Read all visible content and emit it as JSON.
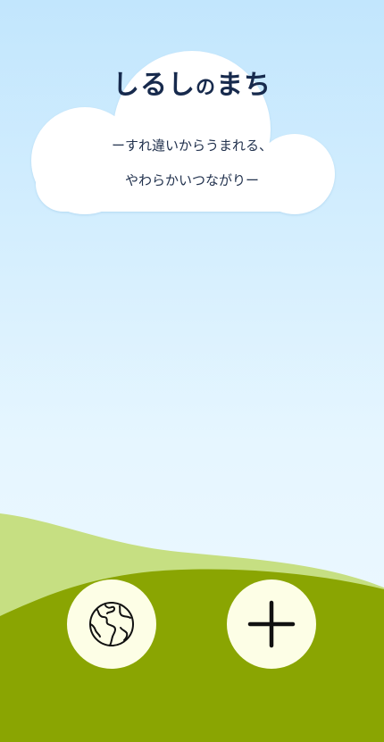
{
  "app": {
    "title_main": "しるし",
    "title_particle": "の",
    "title_end": "まち",
    "tagline_line1": "ーすれ違いからうまれる、",
    "tagline_line2": "やわらかいつながりー"
  },
  "colors": {
    "sky_top": "#c2e6fd",
    "sky_bottom": "#eef9ff",
    "cloud": "#ffffff",
    "hill_back": "#c6df82",
    "hill_front": "#8aa502",
    "button_bg": "#fdfee6",
    "title_text": "#172a4d"
  },
  "buttons": {
    "explore": {
      "icon": "globe-icon"
    },
    "add": {
      "icon": "plus-icon"
    }
  }
}
